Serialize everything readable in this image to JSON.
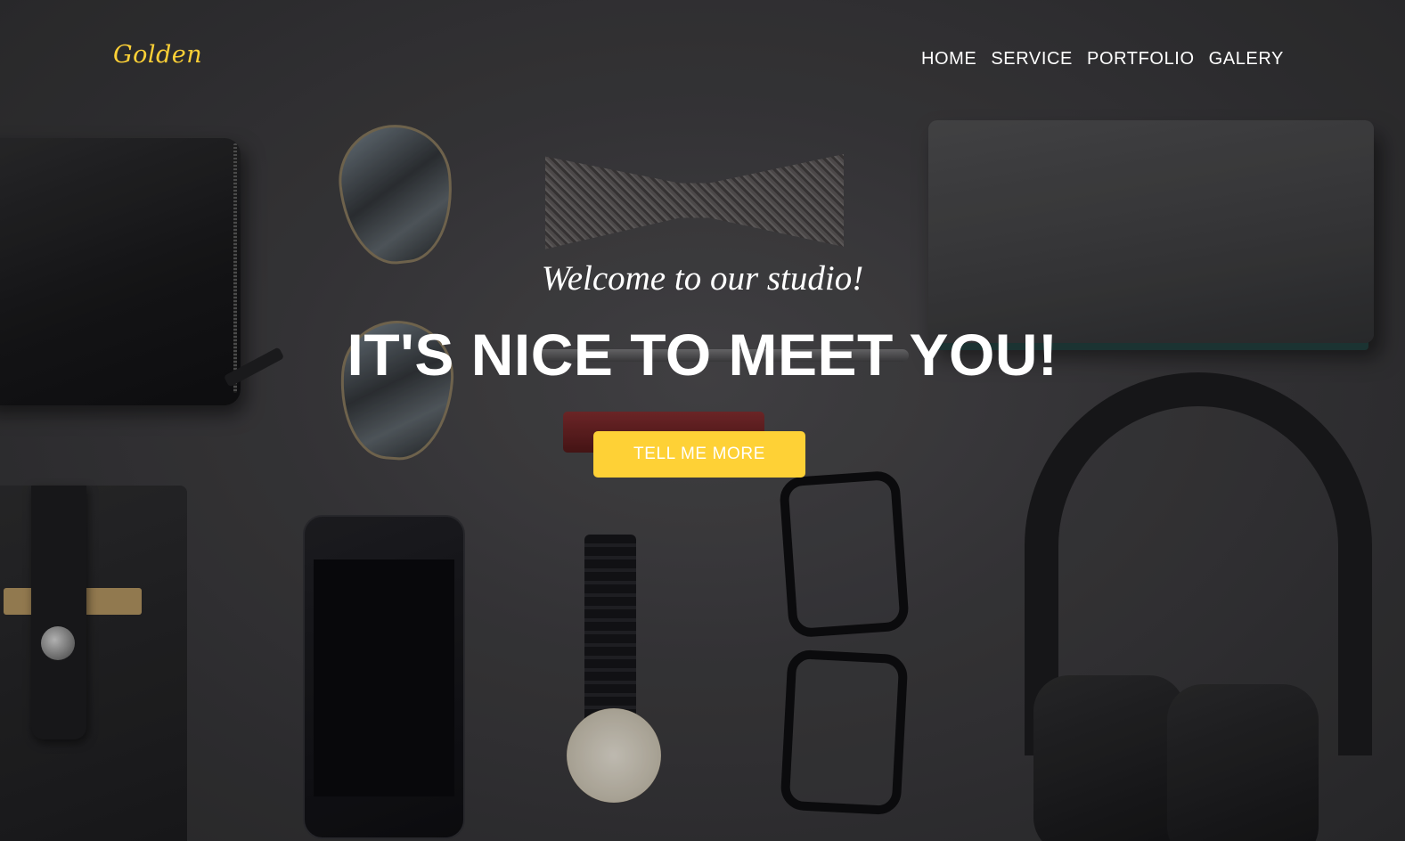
{
  "brand": {
    "logo_text": "Golden",
    "accent_color": "#fed136"
  },
  "nav": {
    "items": [
      {
        "label": "HOME"
      },
      {
        "label": "SERVICE"
      },
      {
        "label": "PORTFOLIO"
      },
      {
        "label": "GALERY"
      }
    ]
  },
  "hero": {
    "subtitle": "Welcome to our studio!",
    "title": "IT'S NICE TO MEET YOU!",
    "cta_label": "TELL ME MORE",
    "background_image": "flat-lay-accessories-photo"
  }
}
